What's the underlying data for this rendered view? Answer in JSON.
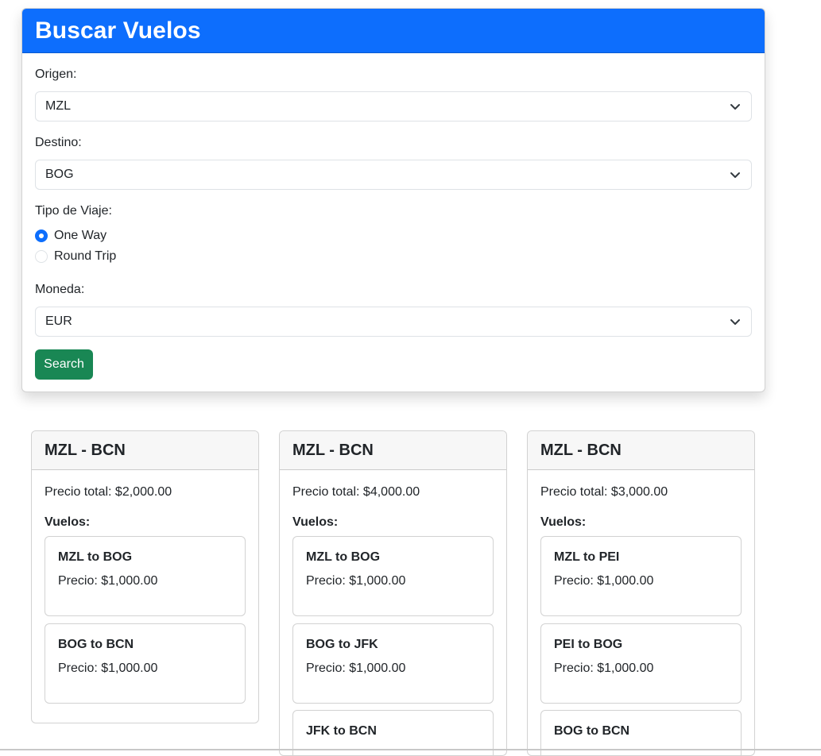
{
  "search": {
    "title": "Buscar Vuelos",
    "origin_label": "Origen:",
    "origin_value": "MZL",
    "destination_label": "Destino:",
    "destination_value": "BOG",
    "trip_type_label": "Tipo de Viaje:",
    "trip_options": [
      "One Way",
      "Round Trip"
    ],
    "trip_selected": "One Way",
    "currency_label": "Moneda:",
    "currency_value": "EUR",
    "search_button": "Search"
  },
  "results": [
    {
      "route": "MZL - BCN",
      "total": "Precio total: $2,000.00",
      "flights_label": "Vuelos:",
      "flights": [
        {
          "title": "MZL to BOG",
          "price": "Precio: $1,000.00"
        },
        {
          "title": "BOG to BCN",
          "price": "Precio: $1,000.00"
        }
      ]
    },
    {
      "route": "MZL - BCN",
      "total": "Precio total: $4,000.00",
      "flights_label": "Vuelos:",
      "flights": [
        {
          "title": "MZL to BOG",
          "price": "Precio: $1,000.00"
        },
        {
          "title": "BOG to JFK",
          "price": "Precio: $1,000.00"
        },
        {
          "title": "JFK to BCN",
          "price": ""
        }
      ]
    },
    {
      "route": "MZL - BCN",
      "total": "Precio total: $3,000.00",
      "flights_label": "Vuelos:",
      "flights": [
        {
          "title": "MZL to PEI",
          "price": "Precio: $1,000.00"
        },
        {
          "title": "PEI to BOG",
          "price": "Precio: $1,000.00"
        },
        {
          "title": "BOG to BCN",
          "price": ""
        }
      ]
    }
  ],
  "colors": {
    "primary": "#0d6efd",
    "success": "#198754"
  },
  "icons": {
    "select_chevron": "chevron-down-icon"
  }
}
